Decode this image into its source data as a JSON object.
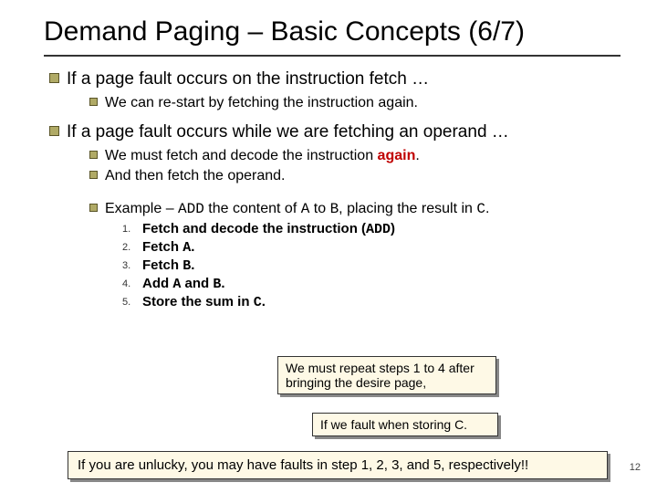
{
  "title": "Demand Paging – Basic Concepts (6/7)",
  "b1": "If a page fault occurs on the instruction fetch …",
  "b1s1": "We can re-start by fetching the instruction again.",
  "b2": "If a page fault occurs while we are fetching an operand …",
  "b2s1_a": "We must fetch and decode the instruction ",
  "b2s1_b": "again",
  "b2s1_c": ".",
  "b2s2": "And then fetch the operand.",
  "b2s3_a": "Example – ",
  "b2s3_b": "ADD",
  "b2s3_c": " the content of ",
  "b2s3_d": "A",
  "b2s3_e": " to ",
  "b2s3_f": "B",
  "b2s3_g": ", placing the result in ",
  "b2s3_h": "C",
  "b2s3_i": ".",
  "step1_a": "Fetch and decode the instruction (",
  "step1_b": "ADD",
  "step1_c": ")",
  "step2_a": "Fetch ",
  "step2_b": "A",
  "step2_c": ".",
  "step3_a": "Fetch ",
  "step3_b": "B",
  "step3_c": ".",
  "step4_a": "Add ",
  "step4_b": "A",
  "step4_c": " and ",
  "step4_d": "B",
  "step4_e": ".",
  "step5_a": "Store the sum in ",
  "step5_b": "C",
  "step5_c": ".",
  "n1": "1.",
  "n2": "2.",
  "n3": "3.",
  "n4": "4.",
  "n5": "5.",
  "call1": "We must repeat steps 1 to 4 after bringing the desire page,",
  "call2": "If we fault when storing C.",
  "footer": "If you are unlucky, you may have faults in step 1, 2, 3, and 5, respectively!!",
  "page": "12"
}
